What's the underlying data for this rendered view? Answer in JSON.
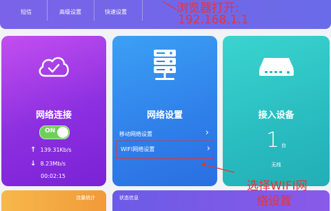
{
  "topnav": {
    "items": [
      "短信",
      "高级设置",
      "快速设置"
    ]
  },
  "cards": {
    "network": {
      "title": "网络连接",
      "toggle_label": "ON",
      "upload_rate": "139.31Kb/s",
      "download_rate": "8.23Mb/s",
      "uptime": "00:02:15"
    },
    "settings": {
      "title": "网络设置",
      "links": [
        "移动网络设置",
        "WIFI网络设置"
      ]
    },
    "devices": {
      "title": "接入设备",
      "count": "1",
      "count_unit": "台",
      "type": "无线"
    }
  },
  "bottom": {
    "traffic_label": "流量统计",
    "status_label": "状态信息"
  },
  "annotations": {
    "browser_line1": "浏览器打开:",
    "browser_line2": "192.168.1.1",
    "select_line1": "选择WIFI网",
    "select_line2": "络设置"
  },
  "colors": {
    "accent_red": "#e8323a",
    "network_card": "#9b34e6",
    "settings_card": "#2f7fe9",
    "devices_card": "#29bcc0",
    "toggle_on": "#6ed058"
  }
}
